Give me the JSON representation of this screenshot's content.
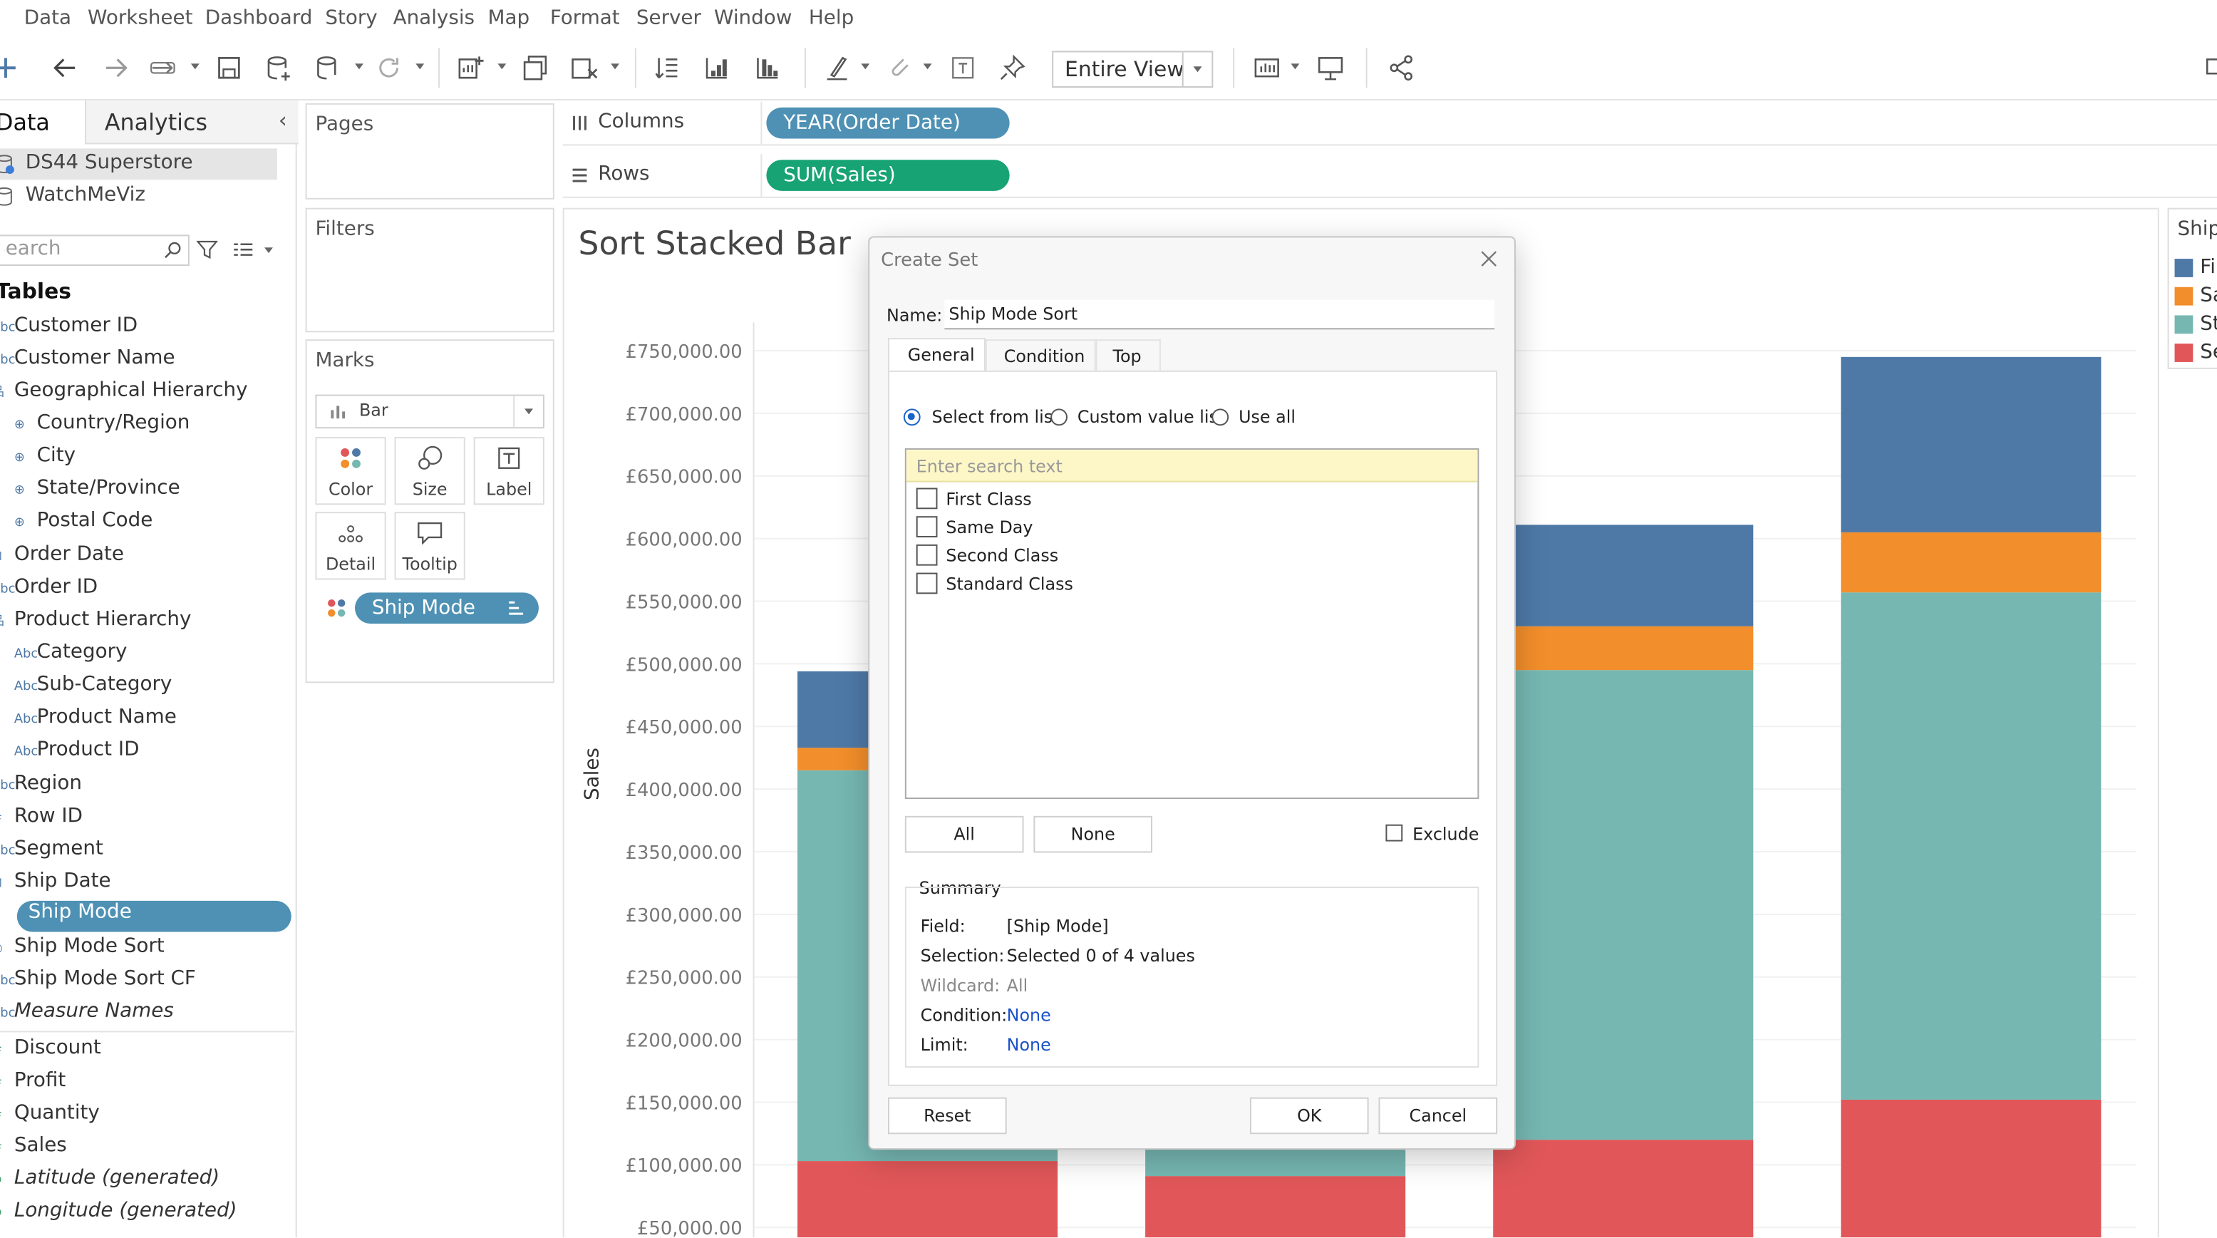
{
  "menu": [
    "Data",
    "Worksheet",
    "Dashboard",
    "Story",
    "Analysis",
    "Map",
    "Format",
    "Server",
    "Window",
    "Help"
  ],
  "toolbar": {
    "view_select": "Entire View"
  },
  "data_pane": {
    "tab_data": "Data",
    "tab_analytics": "Analytics",
    "datasources": [
      "DS44 Superstore",
      "WatchMeViz"
    ],
    "search_placeholder": "Search",
    "tables_heading": "Tables",
    "fields": [
      {
        "type": "Abc",
        "name": "Customer ID"
      },
      {
        "type": "Abc",
        "name": "Customer Name"
      },
      {
        "type": "hier",
        "name": "Geographical Hierarchy"
      },
      {
        "type": "geo",
        "name": "Country/Region"
      },
      {
        "type": "geo",
        "name": "City"
      },
      {
        "type": "geo",
        "name": "State/Province"
      },
      {
        "type": "geo",
        "name": "Postal Code"
      },
      {
        "type": "date",
        "name": "Order Date"
      },
      {
        "type": "Abc",
        "name": "Order ID"
      },
      {
        "type": "hier",
        "name": "Product Hierarchy"
      },
      {
        "type": "Abc",
        "name": "Category"
      },
      {
        "type": "Abc",
        "name": "Sub-Category"
      },
      {
        "type": "Abc",
        "name": "Product Name"
      },
      {
        "type": "Abc",
        "name": "Product ID"
      },
      {
        "type": "Abc",
        "name": "Region"
      },
      {
        "type": "#",
        "name": "Row ID"
      },
      {
        "type": "Abc",
        "name": "Segment"
      },
      {
        "type": "date",
        "name": "Ship Date"
      },
      {
        "type": "Abc",
        "name": "Ship Mode"
      },
      {
        "type": "set",
        "name": "Ship Mode Sort"
      },
      {
        "type": "Abc",
        "name": "Ship Mode Sort CF"
      },
      {
        "type": "Abc",
        "name": "Measure Names"
      },
      {
        "type": "#",
        "name": "Discount"
      },
      {
        "type": "#",
        "name": "Profit"
      },
      {
        "type": "#",
        "name": "Quantity"
      },
      {
        "type": "#",
        "name": "Sales"
      },
      {
        "type": "geo",
        "name": "Latitude (generated)"
      },
      {
        "type": "geo",
        "name": "Longitude (generated)"
      }
    ]
  },
  "shelves": {
    "pages": "Pages",
    "filters": "Filters",
    "columns_label": "Columns",
    "rows_label": "Rows",
    "columns_pill": "YEAR(Order Date)",
    "rows_pill": "SUM(Sales)"
  },
  "marks": {
    "title": "Marks",
    "type": "Bar",
    "buttons": [
      "Color",
      "Size",
      "Label",
      "Detail",
      "Tooltip"
    ],
    "color_pill": "Ship Mode"
  },
  "chart_data": {
    "type": "bar",
    "title": "Sort Stacked Bar",
    "ylabel": "Sales",
    "ylim": [
      0,
      760000
    ],
    "yticks": [
      "£750,000.00",
      "£700,000.00",
      "£650,000.00",
      "£600,000.00",
      "£550,000.00",
      "£500,000.00",
      "£450,000.00",
      "£400,000.00",
      "£350,000.00",
      "£300,000.00",
      "£250,000.00",
      "£200,000.00",
      "£150,000.00",
      "£100,000.00",
      "£50,000.00"
    ],
    "series": [
      {
        "name": "Standard Class",
        "color": "#e15759",
        "values": [
          103000,
          91000,
          120000,
          152000
        ]
      },
      {
        "name": "Second Class",
        "color": "#76b7b2",
        "values": [
          312000,
          340000,
          375000,
          405000
        ]
      },
      {
        "name": "Same Day",
        "color": "#f28e2b",
        "values": [
          18000,
          30000,
          35000,
          48000
        ]
      },
      {
        "name": "First Class",
        "color": "#4e79a7",
        "values": [
          61000,
          91000,
          81000,
          140000
        ]
      }
    ]
  },
  "legend": {
    "title": "Ship",
    "items": [
      {
        "label": "Fi",
        "color": "#4e79a7"
      },
      {
        "label": "Sa",
        "color": "#f28e2b"
      },
      {
        "label": "St",
        "color": "#76b7b2"
      },
      {
        "label": "Se",
        "color": "#e15759"
      }
    ]
  },
  "dialog": {
    "title": "Create Set",
    "name_label": "Name:",
    "name_value": "Ship Mode Sort",
    "tabs": [
      "General",
      "Condition",
      "Top"
    ],
    "radio_select": "Select from list",
    "radio_custom": "Custom value list",
    "radio_all": "Use all",
    "search_placeholder": "Enter search text",
    "items": [
      "First Class",
      "Same Day",
      "Second Class",
      "Standard Class"
    ],
    "btn_all": "All",
    "btn_none": "None",
    "exclude": "Exclude",
    "summary_title": "Summary",
    "summary": {
      "field_label": "Field:",
      "field_value": "[Ship Mode]",
      "selection_label": "Selection:",
      "selection_value": "Selected 0 of 4 values",
      "wildcard_label": "Wildcard:",
      "wildcard_value": "All",
      "condition_label": "Condition:",
      "condition_value": "None",
      "limit_label": "Limit:",
      "limit_value": "None"
    },
    "btn_reset": "Reset",
    "btn_ok": "OK",
    "btn_cancel": "Cancel"
  }
}
